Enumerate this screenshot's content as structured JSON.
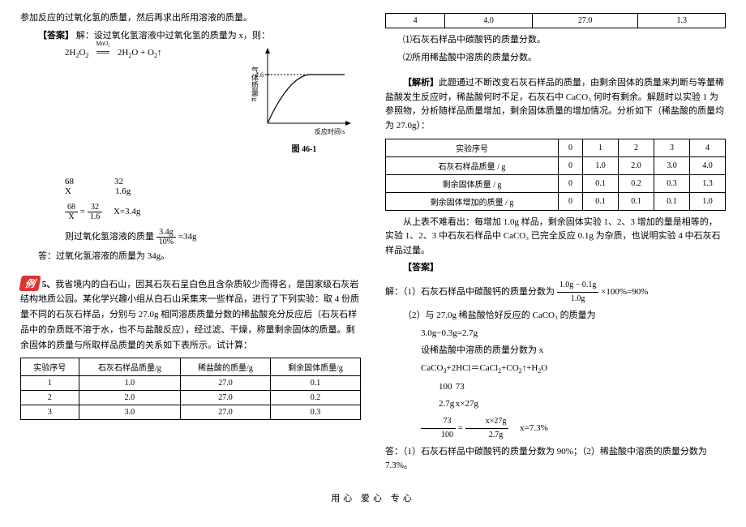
{
  "left": {
    "line1": "参加反应的过氧化氢的质量，然后再求出所用溶液的质量。",
    "ans_label": "【答案】",
    "ans_line": "解：设过氧化氢溶液中过氧化氢的质量为 x，则：",
    "eq_main": "2H₂O₂ ══ 2H₂O + O₂↑",
    "eq_cat": "MnO₂",
    "n68": "68",
    "n32": "32",
    "nX": "X",
    "n16": "1.6g",
    "frac1_num": "68",
    "frac1_den": "X",
    "frac2_num": "32",
    "frac2_den": "1.6",
    "x_res": "X=3.4g",
    "mass_label": "则过氧化氢溶液的质量",
    "mass_num": "3.4g",
    "mass_den": "10%",
    "mass_res": "=34g",
    "ans_final": "答：过氧化氢溶液的质量为 34g。",
    "graph_y": "气体质量/g",
    "graph_x": "反应时间/s",
    "graph_val": "1.6",
    "graph_caption": "图 46-1",
    "ex_badge": "例",
    "ex_num": "5、",
    "q5": "我省境内的白石山，因其石灰石呈白色且含杂质较少而得名，是国家级石灰岩结构地质公园。某化学兴趣小组从白石山采集来一些样品，进行了下列实验：取 4 份质量不同的石灰石样品，分别与 27.0g 相同溶质质量分数的稀盐酸充分反应后（石灰石样品中的杂质既不溶于水，也不与盐酸反应），经过滤、干燥，称量剩余固体的质量。剩余固体的质量与所取样品质量的关系如下表所示。试计算：",
    "t1": {
      "h1": "实验序号",
      "h2": "石灰石样品质量/g",
      "h3": "稀盐酸的质量/g",
      "h4": "剩余固体质量/g",
      "rows": [
        [
          "1",
          "1.0",
          "27.0",
          "0.1"
        ],
        [
          "2",
          "2.0",
          "27.0",
          "0.2"
        ],
        [
          "3",
          "3.0",
          "27.0",
          "0.3"
        ]
      ]
    }
  },
  "right": {
    "t1row4": [
      "4",
      "4.0",
      "27.0",
      "1.3"
    ],
    "q1": "⑴石灰石样品中碳酸钙的质量分数。",
    "q2": "⑵所用稀盐酸中溶质的质量分数。",
    "analysis_label": "【解析】",
    "analysis": "此题通过不断改变石灰石样品的质量，由剩余固体的质量来判断与等量稀盐酸发生反应时，稀盐酸何时不足，石灰石中 CaCO₃ 何时有剩余。解题时以实验 1 为参照物，分析随样品质量增加，剩余固体质量的增加情况。分析如下（稀盐酸的质量均为 27.0g）：",
    "t2": {
      "r1": [
        "实验序号",
        "0",
        "1",
        "2",
        "3",
        "4"
      ],
      "r2": [
        "石灰石样品质量 / g",
        "0",
        "1.0",
        "2.0",
        "3.0",
        "4.0"
      ],
      "r3": [
        "剩余固体质量 / g",
        "0",
        "0.1",
        "0.2",
        "0.3",
        "1.3"
      ],
      "r4": [
        "剩余固体增加的质量 / g",
        "0",
        "0.1",
        "0.1",
        "0.1",
        "1.0"
      ]
    },
    "concl": "从上表不难看出：每增加 1.0g 样品，剩余固体实验 1、2、3 增加的量是相等的，实验 1、2、3 中石灰石样品中 CaCO₃ 已完全反应 0.1g 为杂质，也说明实验 4 中石灰石样品过量。",
    "ans_label": "【答案】",
    "s1_label": "解：（1）石灰石样品中碳酸钙的质量分数为",
    "s1_num": "1.0g − 0.1g",
    "s1_den": "1.0g",
    "s1_tail": "×100%=90%",
    "s2": "（2）与 27.0g 稀盐酸恰好反应的 CaCO₃ 的质量为",
    "s2_calc": "3.0g−0.3g=2.7g",
    "s3": "设稀盐酸中溶质的质量分数为 x",
    "s4": "CaCO₃+2HCl＝CaCl₂+CO₂↑+H₂O",
    "s5a": "100",
    "s5b": "73",
    "s6a": "2.7g",
    "s6b": "x×27g",
    "frac_a_num": "73",
    "frac_a_den": "100",
    "frac_b_num": "x×27g",
    "frac_b_den": "2.7g",
    "x_res": "x=7.3%",
    "final": "答：（1）石灰石样品中碳酸钙的质量分数为 90%；（2）稀盐酸中溶质的质量分数为 7.3%。"
  },
  "footer": "用心  爱心  专心",
  "chart_data": {
    "type": "line",
    "title": "图 46-1",
    "xlabel": "反应时间/s",
    "ylabel": "气体质量/g",
    "series": [
      {
        "name": "O₂ mass",
        "description": "rises from 0, levels off at 1.6"
      }
    ],
    "ylim": [
      0,
      1.6
    ],
    "plateau_value": 1.6
  }
}
